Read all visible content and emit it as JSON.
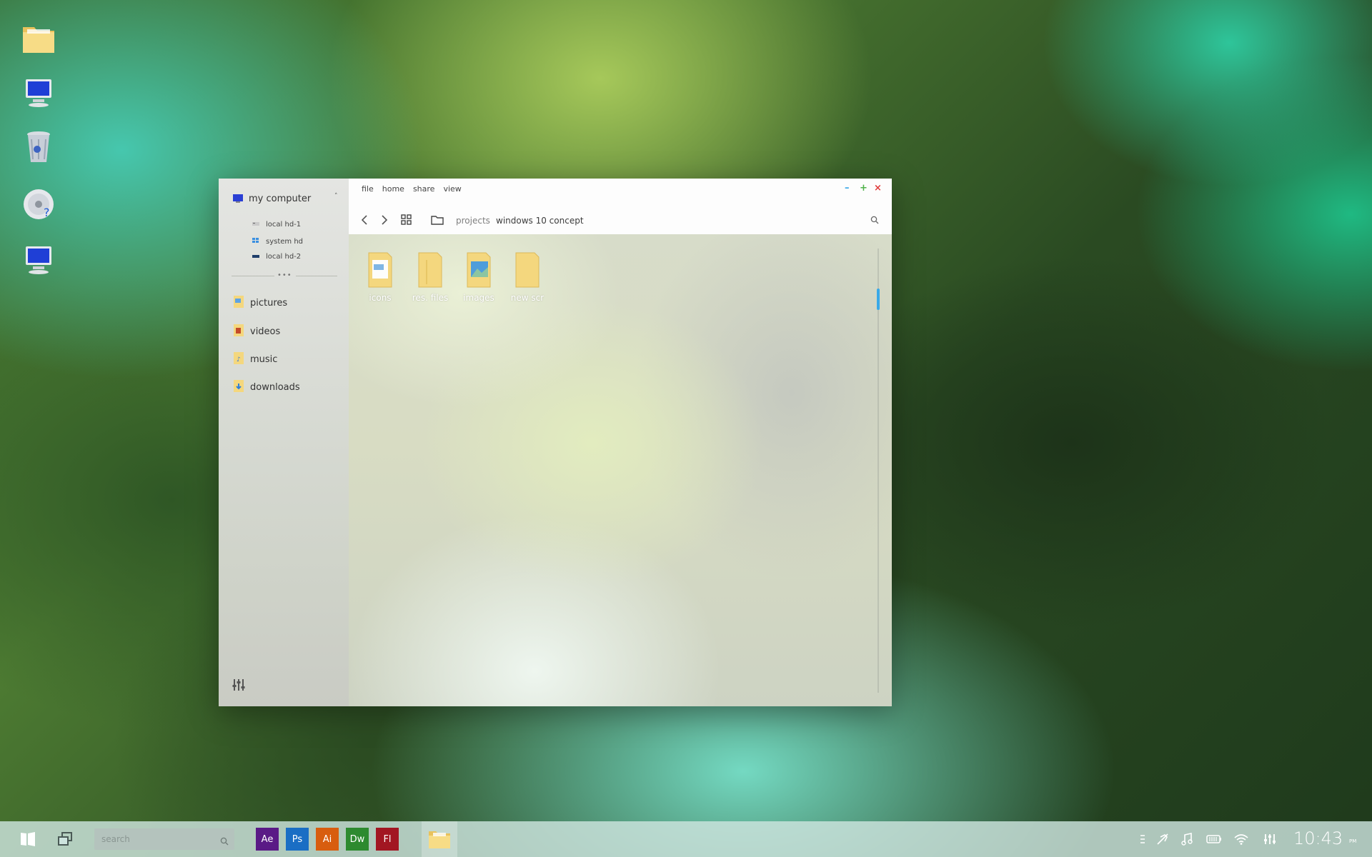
{
  "desktop": {
    "icons": [
      {
        "name": "folder-icon"
      },
      {
        "name": "computer-icon"
      },
      {
        "name": "recycle-bin-icon"
      },
      {
        "name": "disc-icon"
      },
      {
        "name": "computer-icon"
      }
    ]
  },
  "window": {
    "menu": [
      "file",
      "home",
      "share",
      "view"
    ],
    "controls": {
      "minimize": "–",
      "maximize": "+",
      "close": "×"
    },
    "breadcrumb": [
      "projects",
      "windows 10 concept"
    ],
    "sidebar": {
      "computer_label": "my computer",
      "drives": [
        "local hd-1",
        "system hd",
        "local hd-2"
      ],
      "libraries": [
        "pictures",
        "videos",
        "music",
        "downloads"
      ]
    },
    "files": [
      {
        "label": "icons",
        "icon": "folder-icon"
      },
      {
        "label": "res. files",
        "icon": "folder-icon"
      },
      {
        "label": "images",
        "icon": "folder-images-icon"
      },
      {
        "label": "new scr",
        "icon": "folder-icon"
      }
    ]
  },
  "taskbar": {
    "search_placeholder": "search",
    "apps": [
      {
        "label": "Ae",
        "color": "#5a1a86"
      },
      {
        "label": "Ps",
        "color": "#1a6ec4"
      },
      {
        "label": "Ai",
        "color": "#d85d0f"
      },
      {
        "label": "Dw",
        "color": "#2d8a2f"
      },
      {
        "label": "Fl",
        "color": "#a21622"
      }
    ],
    "time": "10:43",
    "ampm": "PM"
  },
  "colors": {
    "accent": "#39a9e8",
    "folder": "#f4d77e",
    "minimize": "#3aa7e6",
    "maximize": "#4fb24a",
    "close": "#e03b3b"
  }
}
